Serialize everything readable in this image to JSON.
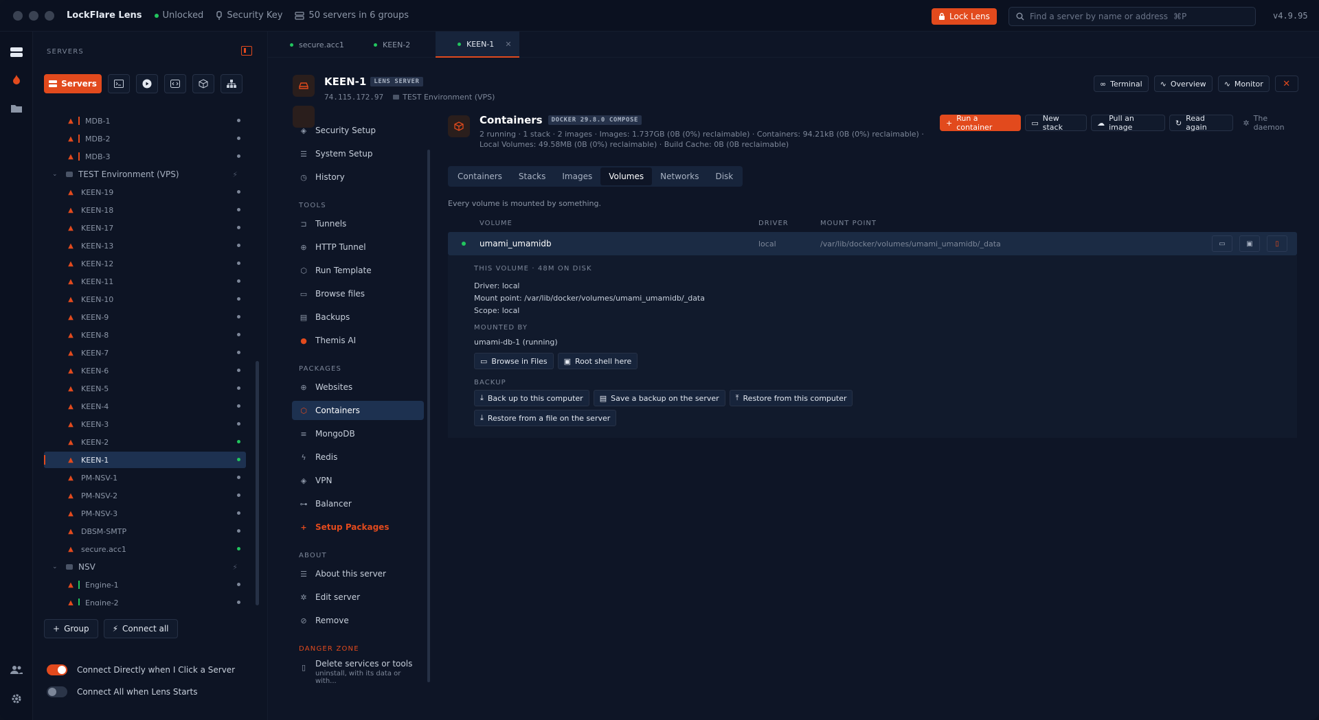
{
  "titlebar": {
    "app_name": "LockFlare Lens",
    "status": "Unlocked",
    "key": "Security Key",
    "servers_count": "50 servers in 6 groups",
    "lock_label": "Lock Lens",
    "search_placeholder": "Find a server by name or address",
    "search_shortcut": "⌘P",
    "version": "v4.9.95"
  },
  "sidebar": {
    "heading": "SERVERS",
    "servers_button": "Servers",
    "tree": {
      "top_items": [
        "MDB-1",
        "MDB-2",
        "MDB-3"
      ],
      "group_test": "TEST Environment (VPS)",
      "test_items": [
        "KEEN-19",
        "KEEN-18",
        "KEEN-17",
        "KEEN-13",
        "KEEN-12",
        "KEEN-11",
        "KEEN-10",
        "KEEN-9",
        "KEEN-8",
        "KEEN-7",
        "KEEN-6",
        "KEEN-5",
        "KEEN-4",
        "KEEN-3",
        "KEEN-2",
        "KEEN-1",
        "PM-NSV-1",
        "PM-NSV-2",
        "PM-NSV-3",
        "DBSM-SMTP",
        "secure.acc1"
      ],
      "group_nsv": "NSV",
      "nsv_items": [
        "Engine-1",
        "Engine-2"
      ]
    },
    "group_button": "Group",
    "connect_all_button": "Connect all",
    "toggle_direct": "Connect Directly when I Click a Server",
    "toggle_all": "Connect All when Lens Starts"
  },
  "tabs": [
    {
      "label": "secure.acc1"
    },
    {
      "label": "KEEN-2"
    },
    {
      "label": "KEEN-1"
    }
  ],
  "server": {
    "name": "KEEN-1",
    "badge": "LENS SERVER",
    "ip": "74.115.172.97",
    "group": "TEST Environment (VPS)",
    "actions": {
      "terminal": "Terminal",
      "overview": "Overview",
      "monitor": "Monitor"
    }
  },
  "nav": {
    "security_setup": "Security Setup",
    "system_setup": "System Setup",
    "history": "History",
    "tools_heading": "TOOLS",
    "tunnels": "Tunnels",
    "http_tunnel": "HTTP Tunnel",
    "run_template": "Run Template",
    "browse_files": "Browse files",
    "backups": "Backups",
    "themis_ai": "Themis AI",
    "packages_heading": "PACKAGES",
    "websites": "Websites",
    "containers": "Containers",
    "mongodb": "MongoDB",
    "redis": "Redis",
    "vpn": "VPN",
    "balancer": "Balancer",
    "setup_packages": "Setup Packages",
    "about_heading": "ABOUT",
    "about_server": "About this server",
    "edit_server": "Edit server",
    "remove": "Remove",
    "danger_heading": "DANGER ZONE",
    "delete_services": "Delete services or tools",
    "delete_sub": "uninstall, with its data or with..."
  },
  "containers": {
    "title": "Containers",
    "badge": "DOCKER 29.8.0 COMPOSE",
    "meta": "2 running · 1 stack · 2 images · Images: 1.737GB (0B (0%) reclaimable) · Containers: 94.21kB (0B (0%) reclaimable) · Local Volumes: 49.58MB (0B (0%) reclaimable) · Build Cache: 0B (0B reclaimable)",
    "run_container": "Run a container",
    "new_stack": "New stack",
    "pull_image": "Pull an image",
    "read_again": "Read again",
    "daemon": "The daemon",
    "subtabs": [
      "Containers",
      "Stacks",
      "Images",
      "Volumes",
      "Networks",
      "Disk"
    ],
    "note": "Every volume is mounted by something.",
    "columns": {
      "volume": "VOLUME",
      "driver": "DRIVER",
      "mount": "MOUNT POINT"
    },
    "volume": {
      "name": "umami_umamidb",
      "driver": "local",
      "mount": "/var/lib/docker/volumes/umami_umamidb/_data"
    },
    "detail": {
      "this_volume": "THIS VOLUME · 48M ON DISK",
      "driver_line": "Driver: local",
      "mount_line": "Mount point: /var/lib/docker/volumes/umami_umamidb/_data",
      "scope_line": "Scope: local",
      "mounted_by": "MOUNTED BY",
      "mounted_item": "umami-db-1 (running)",
      "browse_files": "Browse in Files",
      "root_shell": "Root shell here",
      "backup": "BACKUP",
      "backup_local": "Back up to this computer",
      "backup_server": "Save a backup on the server",
      "restore_local": "Restore from this computer",
      "restore_server": "Restore from a file on the server"
    }
  }
}
